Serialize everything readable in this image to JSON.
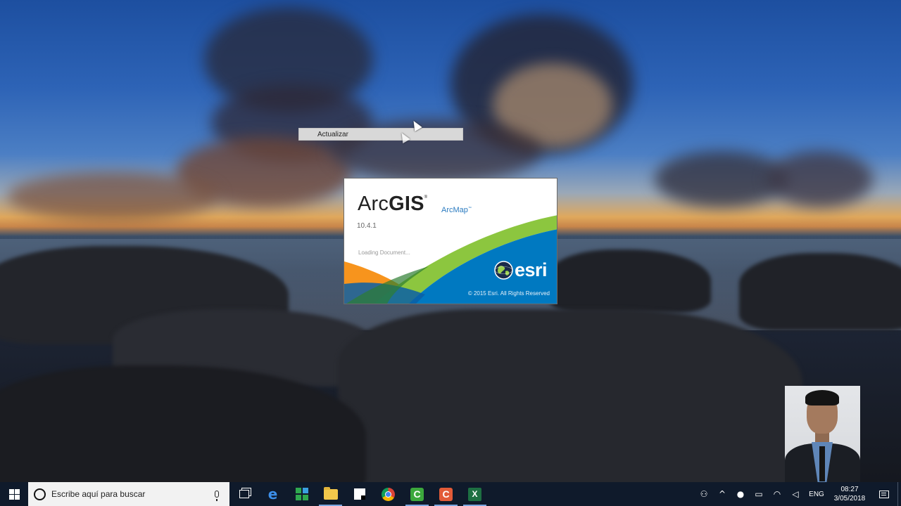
{
  "context_menu": {
    "item_label": "Actualizar"
  },
  "splash": {
    "product_name_light": "Arc",
    "product_name_bold": "GIS",
    "product_trademark": "®",
    "app_name": "ArcMap",
    "app_trademark": "™",
    "version": "10.4.1",
    "status": "Loading Document...",
    "brand": "esri",
    "copyright": "© 2015 Esri. All Rights Reserved",
    "colors": {
      "green": "#8cc63f",
      "blue": "#0079c1",
      "orange": "#f7941d",
      "dark_blue": "#005a9c"
    }
  },
  "taskbar": {
    "search_placeholder": "Escribe aquí para buscar",
    "pinned_apps": [
      "task-view-icon",
      "edge-icon",
      "store-icon",
      "file-explorer-icon",
      "sticky-notes-icon",
      "chrome-icon",
      "green-c-app-icon",
      "red-c-app-icon",
      "excel-icon"
    ],
    "green_app_letter": "C",
    "red_app_letter": "C",
    "excel_letter": "X",
    "tray": {
      "language": "ENG",
      "time": "08:27",
      "date": "3/05/2018"
    }
  }
}
